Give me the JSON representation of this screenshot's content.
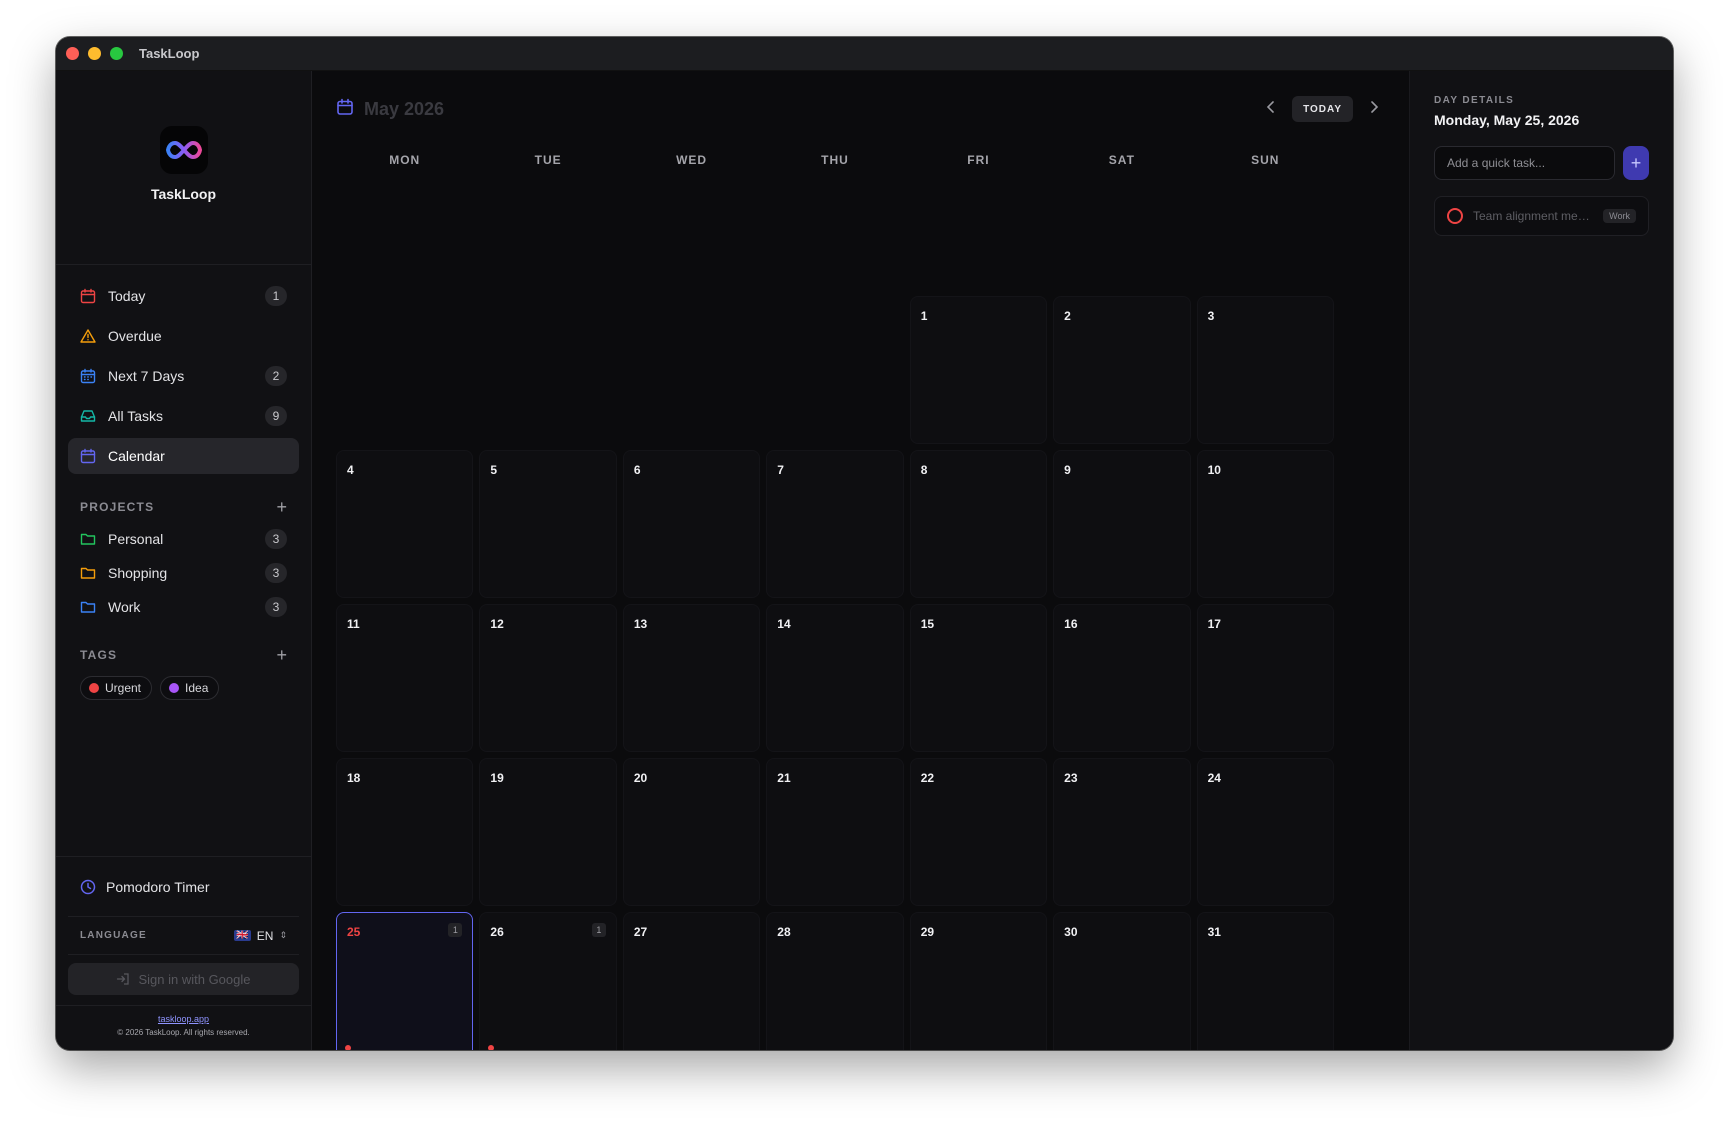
{
  "window": {
    "title": "TaskLoop"
  },
  "brand": {
    "name": "TaskLoop"
  },
  "nav": [
    {
      "key": "today",
      "label": "Today",
      "count": "1",
      "icon": "calendar-icon",
      "color": "#ef4444"
    },
    {
      "key": "overdue",
      "label": "Overdue",
      "count": "",
      "icon": "warning-icon",
      "color": "#f59e0b"
    },
    {
      "key": "next7",
      "label": "Next 7 Days",
      "count": "2",
      "icon": "calendar-range-icon",
      "color": "#3b82f6"
    },
    {
      "key": "all",
      "label": "All Tasks",
      "count": "9",
      "icon": "inbox-icon",
      "color": "#14b8a6"
    },
    {
      "key": "calendar",
      "label": "Calendar",
      "count": "",
      "icon": "calendar-icon",
      "color": "#6366f1",
      "active": true
    }
  ],
  "projects": {
    "title": "PROJECTS",
    "add_label": "+",
    "items": [
      {
        "label": "Personal",
        "count": "3",
        "color": "#22c55e"
      },
      {
        "label": "Shopping",
        "count": "3",
        "color": "#f59e0b"
      },
      {
        "label": "Work",
        "count": "3",
        "color": "#3b82f6"
      }
    ]
  },
  "tags": {
    "title": "TAGS",
    "add_label": "+",
    "items": [
      {
        "label": "Urgent",
        "color": "#ef4444"
      },
      {
        "label": "Idea",
        "color": "#a855f7"
      }
    ]
  },
  "bottom": {
    "pomodoro": "Pomodoro Timer",
    "language_label": "LANGUAGE",
    "language_flag": "🇬🇧",
    "language_value": "EN",
    "signin": "Sign in with Google",
    "link": "taskloop.app",
    "copyright": "© 2026 TaskLoop. All rights reserved."
  },
  "calendar": {
    "title": "May 2026",
    "today_button": "TODAY",
    "prev": "‹",
    "next": "›",
    "weekdays": [
      "MON",
      "TUE",
      "WED",
      "THU",
      "FRI",
      "SAT",
      "SUN"
    ],
    "leading_blanks": 4,
    "days_in_month": 31,
    "selected_day": 25,
    "today_day": 25,
    "task_counts": {
      "25": "1",
      "26": "1"
    },
    "task_dots": [
      25,
      26
    ]
  },
  "details": {
    "label": "DAY DETAILS",
    "date": "Monday, May 25, 2026",
    "quick_placeholder": "Add a quick task...",
    "add_label": "+",
    "tasks": [
      {
        "text": "Team alignment meeting #U...",
        "tag": "Work"
      }
    ]
  },
  "colors": {
    "accent": "#6366f1",
    "today": "#ef4444"
  }
}
